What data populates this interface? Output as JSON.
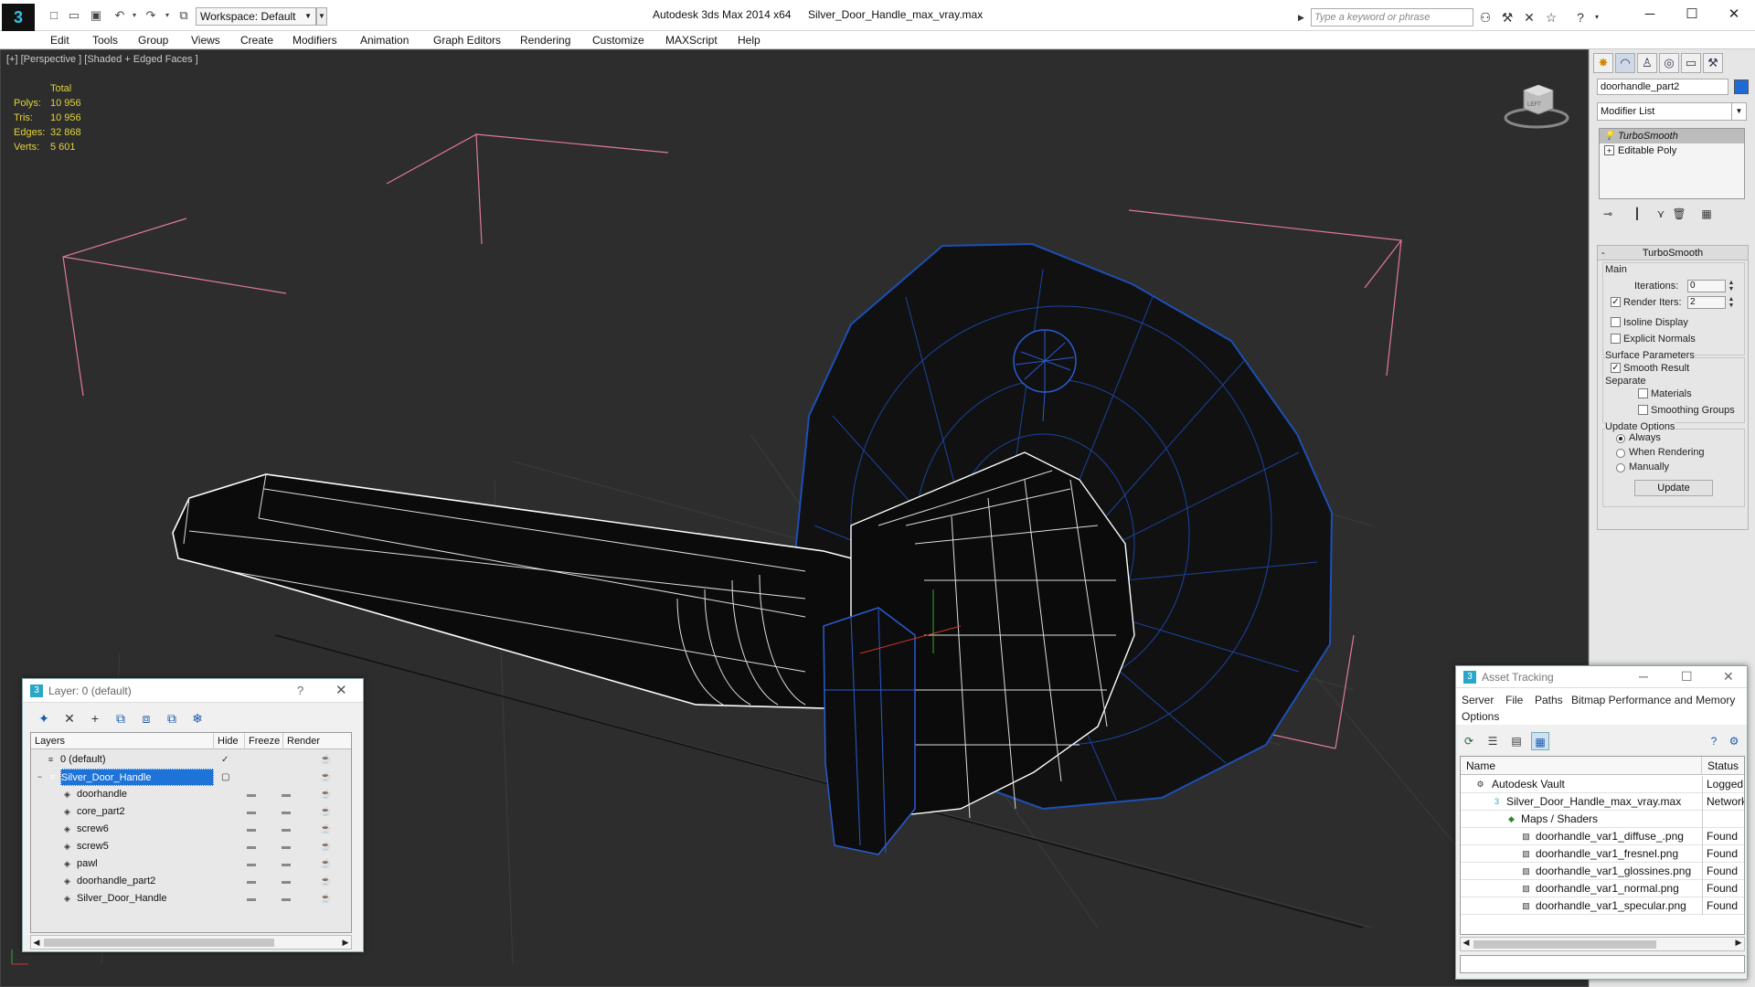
{
  "window": {
    "app_title": "Autodesk 3ds Max  2014 x64",
    "file_title": "Silver_Door_Handle_max_vray.max",
    "workspace": "Workspace: Default",
    "search_placeholder": "Type a keyword or phrase"
  },
  "menu": [
    "Edit",
    "Tools",
    "Group",
    "Views",
    "Create",
    "Modifiers",
    "Animation",
    "Graph Editors",
    "Rendering",
    "Customize",
    "MAXScript",
    "Help"
  ],
  "viewport": {
    "label": "[+] [Perspective ] [Shaded + Edged Faces ]",
    "stats_header": "Total",
    "stats": [
      {
        "label": "Polys:",
        "value": "10 956"
      },
      {
        "label": "Tris:",
        "value": "10 956"
      },
      {
        "label": "Edges:",
        "value": "32 868"
      },
      {
        "label": "Verts:",
        "value": "5 601"
      }
    ],
    "viewcube_label": "LEFT"
  },
  "command_panel": {
    "object_name": "doorhandle_part2",
    "object_color": "#1e6bd8",
    "modifier_list": "Modifier List",
    "stack": [
      "TurboSmooth",
      "Editable Poly"
    ],
    "rollout_title": "TurboSmooth",
    "main_label": "Main",
    "iterations_label": "Iterations:",
    "iterations_value": "0",
    "render_iters_label": "Render Iters:",
    "render_iters_value": "2",
    "render_iters_checked": true,
    "isoline_label": "Isoline Display",
    "explicit_normals_label": "Explicit Normals",
    "surface_params_label": "Surface Parameters",
    "smooth_result_label": "Smooth Result",
    "separate_label": "Separate",
    "materials_label": "Materials",
    "smoothing_groups_label": "Smoothing Groups",
    "update_options_label": "Update Options",
    "always_label": "Always",
    "when_rendering_label": "When Rendering",
    "manually_label": "Manually",
    "update_button": "Update"
  },
  "layer_dialog": {
    "title": "Layer: 0 (default)",
    "help": "?",
    "columns": [
      "Layers",
      "Hide",
      "Freeze",
      "Render"
    ],
    "rows": [
      {
        "name": "0 (default)",
        "level": 0,
        "selected": false,
        "current": true
      },
      {
        "name": "Silver_Door_Handle",
        "level": 0,
        "selected": true,
        "current": false
      },
      {
        "name": "doorhandle",
        "level": 1,
        "selected": false,
        "current": false
      },
      {
        "name": "core_part2",
        "level": 1,
        "selected": false,
        "current": false
      },
      {
        "name": "screw6",
        "level": 1,
        "selected": false,
        "current": false
      },
      {
        "name": "screw5",
        "level": 1,
        "selected": false,
        "current": false
      },
      {
        "name": "pawl",
        "level": 1,
        "selected": false,
        "current": false
      },
      {
        "name": "doorhandle_part2",
        "level": 1,
        "selected": false,
        "current": false
      },
      {
        "name": "Silver_Door_Handle",
        "level": 1,
        "selected": false,
        "current": false
      }
    ]
  },
  "asset_dialog": {
    "title": "Asset Tracking",
    "menu": [
      "Server",
      "File",
      "Paths",
      "Bitmap Performance and Memory",
      "Options"
    ],
    "columns": [
      "Name",
      "Status"
    ],
    "rows": [
      {
        "name": "Autodesk Vault",
        "status": "Logged O",
        "level": 0
      },
      {
        "name": "Silver_Door_Handle_max_vray.max",
        "status": "Network",
        "level": 1
      },
      {
        "name": "Maps / Shaders",
        "status": "",
        "level": 2
      },
      {
        "name": "doorhandle_var1_diffuse_.png",
        "status": "Found",
        "level": 3
      },
      {
        "name": "doorhandle_var1_fresnel.png",
        "status": "Found",
        "level": 3
      },
      {
        "name": "doorhandle_var1_glossines.png",
        "status": "Found",
        "level": 3
      },
      {
        "name": "doorhandle_var1_normal.png",
        "status": "Found",
        "level": 3
      },
      {
        "name": "doorhandle_var1_specular.png",
        "status": "Found",
        "level": 3
      }
    ]
  }
}
